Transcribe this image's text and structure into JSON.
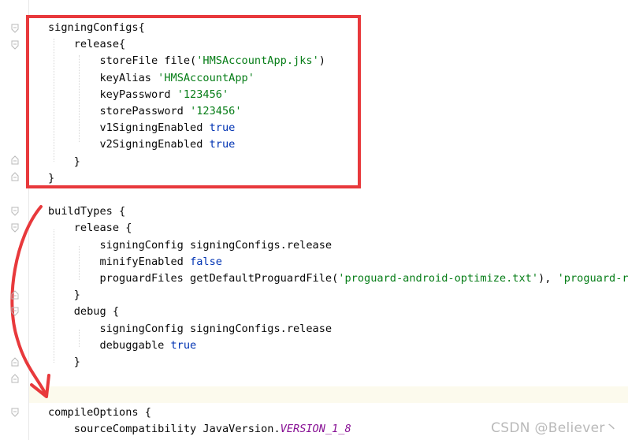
{
  "editor": {
    "lines": [
      {
        "tokens": [
          {
            "t": "signingConfigs{",
            "c": "plain"
          }
        ]
      },
      {
        "tokens": [
          {
            "t": "    release{",
            "c": "plain"
          }
        ]
      },
      {
        "tokens": [
          {
            "t": "        storeFile file(",
            "c": "plain"
          },
          {
            "t": "'HMSAccountApp.jks'",
            "c": "str"
          },
          {
            "t": ")",
            "c": "plain"
          }
        ]
      },
      {
        "tokens": [
          {
            "t": "        keyAlias ",
            "c": "plain"
          },
          {
            "t": "'HMSAccountApp'",
            "c": "str"
          }
        ]
      },
      {
        "tokens": [
          {
            "t": "        keyPassword ",
            "c": "plain"
          },
          {
            "t": "'123456'",
            "c": "str"
          }
        ]
      },
      {
        "tokens": [
          {
            "t": "        storePassword ",
            "c": "plain"
          },
          {
            "t": "'123456'",
            "c": "str"
          }
        ]
      },
      {
        "tokens": [
          {
            "t": "        v1SigningEnabled ",
            "c": "plain"
          },
          {
            "t": "true",
            "c": "kw"
          }
        ]
      },
      {
        "tokens": [
          {
            "t": "        v2SigningEnabled ",
            "c": "plain"
          },
          {
            "t": "true",
            "c": "kw"
          }
        ]
      },
      {
        "tokens": [
          {
            "t": "    }",
            "c": "plain"
          }
        ]
      },
      {
        "tokens": [
          {
            "t": "}",
            "c": "plain"
          }
        ]
      },
      {
        "tokens": []
      },
      {
        "tokens": [
          {
            "t": "buildTypes {",
            "c": "plain"
          }
        ]
      },
      {
        "tokens": [
          {
            "t": "    release {",
            "c": "plain"
          }
        ]
      },
      {
        "tokens": [
          {
            "t": "        signingConfig signingConfigs.release",
            "c": "plain"
          }
        ]
      },
      {
        "tokens": [
          {
            "t": "        minifyEnabled ",
            "c": "plain"
          },
          {
            "t": "false",
            "c": "kw"
          }
        ]
      },
      {
        "tokens": [
          {
            "t": "        proguardFiles getDefaultProguardFile(",
            "c": "plain"
          },
          {
            "t": "'proguard-android-optimize.txt'",
            "c": "str"
          },
          {
            "t": "), ",
            "c": "plain"
          },
          {
            "t": "'proguard-rul",
            "c": "str"
          }
        ]
      },
      {
        "tokens": [
          {
            "t": "    }",
            "c": "plain"
          }
        ]
      },
      {
        "tokens": [
          {
            "t": "    debug {",
            "c": "plain"
          }
        ]
      },
      {
        "tokens": [
          {
            "t": "        signingConfig signingConfigs.release",
            "c": "plain"
          }
        ]
      },
      {
        "tokens": [
          {
            "t": "        debuggable ",
            "c": "plain"
          },
          {
            "t": "true",
            "c": "kw"
          }
        ]
      },
      {
        "tokens": [
          {
            "t": "    }",
            "c": "plain"
          }
        ]
      },
      {
        "tokens": []
      },
      {
        "tokens": []
      },
      {
        "tokens": [
          {
            "t": "compileOptions {",
            "c": "plain"
          }
        ]
      },
      {
        "tokens": [
          {
            "t": "    sourceCompatibility JavaVersion.",
            "c": "plain"
          },
          {
            "t": "VERSION_1_8",
            "c": "const"
          }
        ]
      }
    ]
  },
  "watermark": "CSDN @Believer丶",
  "colors": {
    "annotation": "#e8393c",
    "string": "#067d17",
    "keyword": "#0033b3",
    "constant": "#871094",
    "current_line": "#fcfaed"
  }
}
